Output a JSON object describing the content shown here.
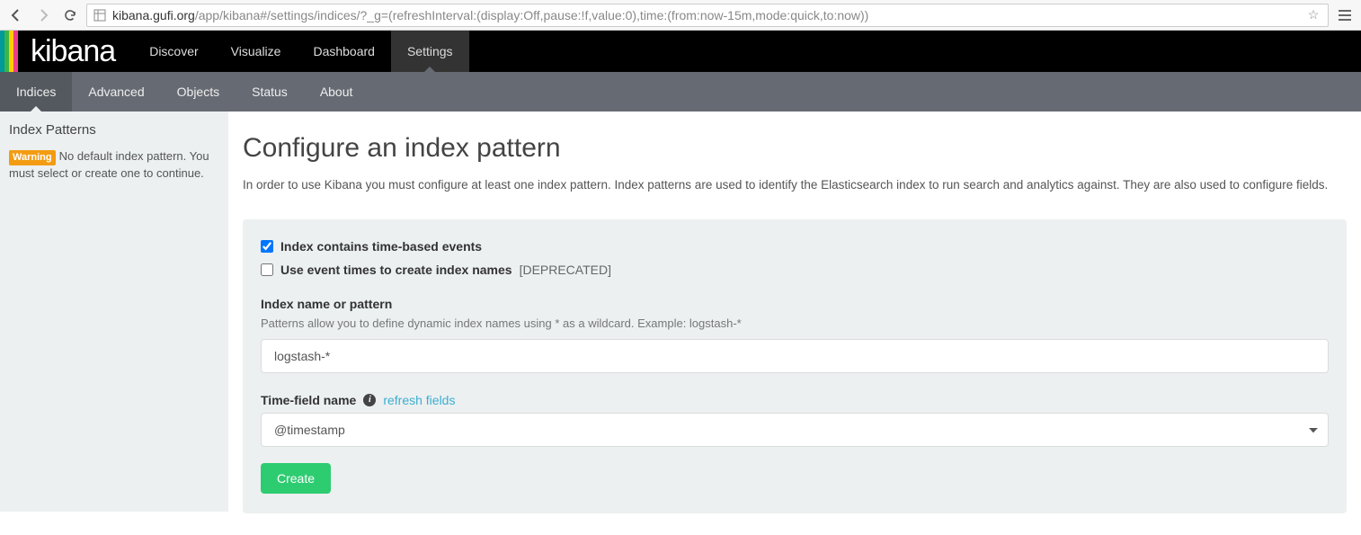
{
  "browser": {
    "url_host": "kibana.gufi.org",
    "url_rest": "/app/kibana#/settings/indices/?_g=(refreshInterval:(display:Off,pause:!f,value:0),time:(from:now-15m,mode:quick,to:now))"
  },
  "topnav": {
    "logo": "kibana",
    "items": [
      "Discover",
      "Visualize",
      "Dashboard",
      "Settings"
    ],
    "active": 3
  },
  "subnav": {
    "items": [
      "Indices",
      "Advanced",
      "Objects",
      "Status",
      "About"
    ],
    "active": 0
  },
  "sidebar": {
    "heading": "Index Patterns",
    "warning_badge": "Warning",
    "warning_text": "No default index pattern. You must select or create one to continue."
  },
  "page": {
    "title": "Configure an index pattern",
    "lead": "In order to use Kibana you must configure at least one index pattern. Index patterns are used to identify the Elasticsearch index to run search and analytics against. They are also used to configure fields."
  },
  "form": {
    "time_based_label": "Index contains time-based events",
    "time_based_checked": true,
    "event_times_label": "Use event times to create index names",
    "event_times_deprecated": "[DEPRECATED]",
    "event_times_checked": false,
    "index_name_label": "Index name or pattern",
    "index_name_hint": "Patterns allow you to define dynamic index names using * as a wildcard. Example: logstash-*",
    "index_name_value": "logstash-*",
    "time_field_label": "Time-field name",
    "refresh_link": "refresh fields",
    "time_field_value": "@timestamp",
    "create_button": "Create"
  }
}
